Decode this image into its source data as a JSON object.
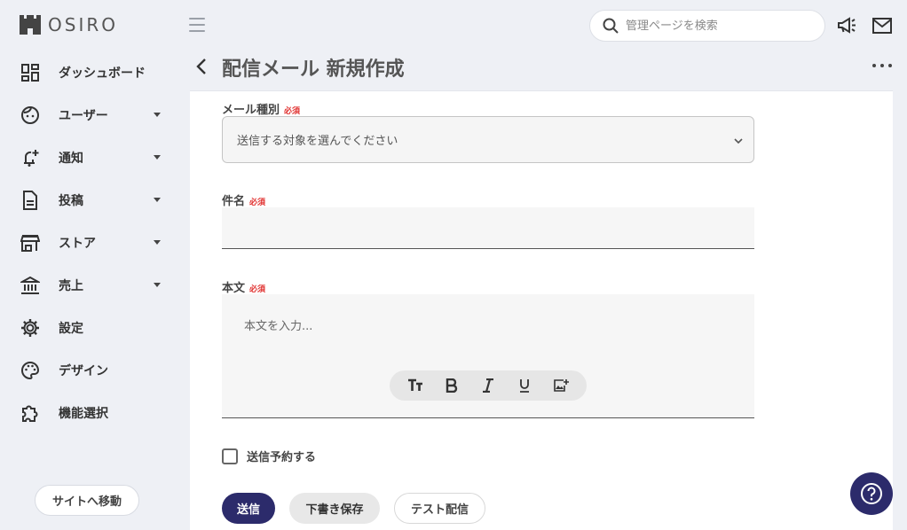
{
  "brand": {
    "logo_text": "OSIRO"
  },
  "sidebar": {
    "items": [
      {
        "label": "ダッシュボード",
        "icon": "dashboard-icon",
        "has_caret": false
      },
      {
        "label": "ユーザー",
        "icon": "user-face-icon",
        "has_caret": true
      },
      {
        "label": "通知",
        "icon": "bell-plus-icon",
        "has_caret": true
      },
      {
        "label": "投稿",
        "icon": "document-icon",
        "has_caret": true
      },
      {
        "label": "ストア",
        "icon": "store-icon",
        "has_caret": true
      },
      {
        "label": "売上",
        "icon": "bank-icon",
        "has_caret": true
      },
      {
        "label": "設定",
        "icon": "gear-icon",
        "has_caret": false
      },
      {
        "label": "デザイン",
        "icon": "palette-icon",
        "has_caret": false
      },
      {
        "label": "機能選択",
        "icon": "puzzle-icon",
        "has_caret": false
      }
    ],
    "site_button": "サイトへ移動"
  },
  "header": {
    "search_placeholder": "管理ページを検索",
    "icons": [
      "megaphone-icon",
      "mail-icon"
    ]
  },
  "page": {
    "title": "配信メール 新規作成"
  },
  "form": {
    "mail_type": {
      "label": "メール種別",
      "required": "必須",
      "value": "送信する対象を選んでください"
    },
    "subject": {
      "label": "件名",
      "required": "必須",
      "value": ""
    },
    "body": {
      "label": "本文",
      "required": "必須",
      "placeholder": "本文を入力..."
    },
    "toolbar": [
      "text-size-icon",
      "bold-icon",
      "italic-icon",
      "underline-icon",
      "add-image-icon"
    ],
    "schedule": {
      "label": "送信予約する",
      "checked": false
    },
    "buttons": {
      "send": "送信",
      "draft": "下書き保存",
      "test": "テスト配信"
    }
  },
  "colors": {
    "primary": "#2c2b6b",
    "required": "#e0302e",
    "background": "#eef0f5"
  }
}
